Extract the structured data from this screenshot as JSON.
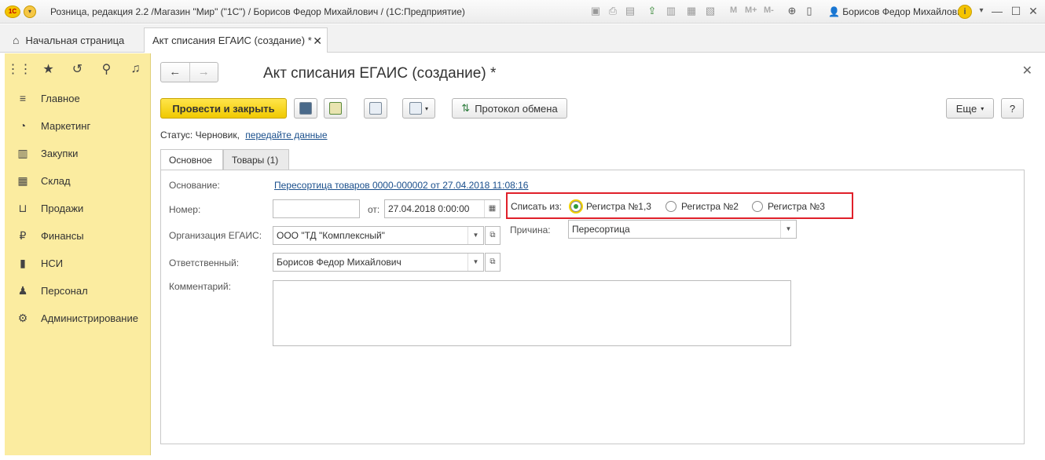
{
  "titlebar": {
    "logo": "1С",
    "text": "Розница, редакция 2.2 /Магазин \"Мир\" (\"1С\") / Борисов Федор Михайлович /  (1С:Предприятие)",
    "m1": "M",
    "m2": "M+",
    "m3": "M-",
    "user": "Борисов Федор Михайлович",
    "info": "i"
  },
  "tabs": {
    "home_label": "Начальная страница",
    "doc_label": "Акт списания ЕГАИС (создание) *"
  },
  "sidebar": {
    "items": [
      {
        "label": "Главное",
        "icon": "menu-icon"
      },
      {
        "label": "Маркетинг",
        "icon": "pie-chart-icon"
      },
      {
        "label": "Закупки",
        "icon": "purchase-icon"
      },
      {
        "label": "Склад",
        "icon": "warehouse-icon"
      },
      {
        "label": "Продажи",
        "icon": "basket-icon"
      },
      {
        "label": "Финансы",
        "icon": "ruble-icon"
      },
      {
        "label": "НСИ",
        "icon": "book-icon"
      },
      {
        "label": "Персонал",
        "icon": "person-icon"
      },
      {
        "label": "Администрирование",
        "icon": "gear-icon"
      }
    ]
  },
  "form": {
    "title": "Акт списания ЕГАИС (создание) *",
    "post_close": "Провести и закрыть",
    "exchange_log": "Протокол обмена",
    "more": "Еще",
    "help": "?",
    "status_label": "Статус:",
    "status_value": "Черновик,",
    "status_link": "передайте данные",
    "tab_main": "Основное",
    "tab_goods": "Товары (1)",
    "basis_label": "Основание:",
    "basis_value": "Пересортица товаров 0000-000002 от 27.04.2018 11:08:16",
    "number_label": "Номер:",
    "number_value": "",
    "date_label": "от:",
    "date_value": "27.04.2018  0:00:00",
    "org_label": "Организация ЕГАИС:",
    "org_value": "ООО \"ТД \"Комплексный\"",
    "resp_label": "Ответственный:",
    "resp_value": "Борисов Федор Михайлович",
    "comment_label": "Комментарий:",
    "writeoff_label": "Списать из:",
    "radio_options": [
      "Регистра №1,3",
      "Регистра №2",
      "Регистра №3"
    ],
    "radio_selected": 0,
    "reason_label": "Причина:",
    "reason_value": "Пересортица"
  }
}
